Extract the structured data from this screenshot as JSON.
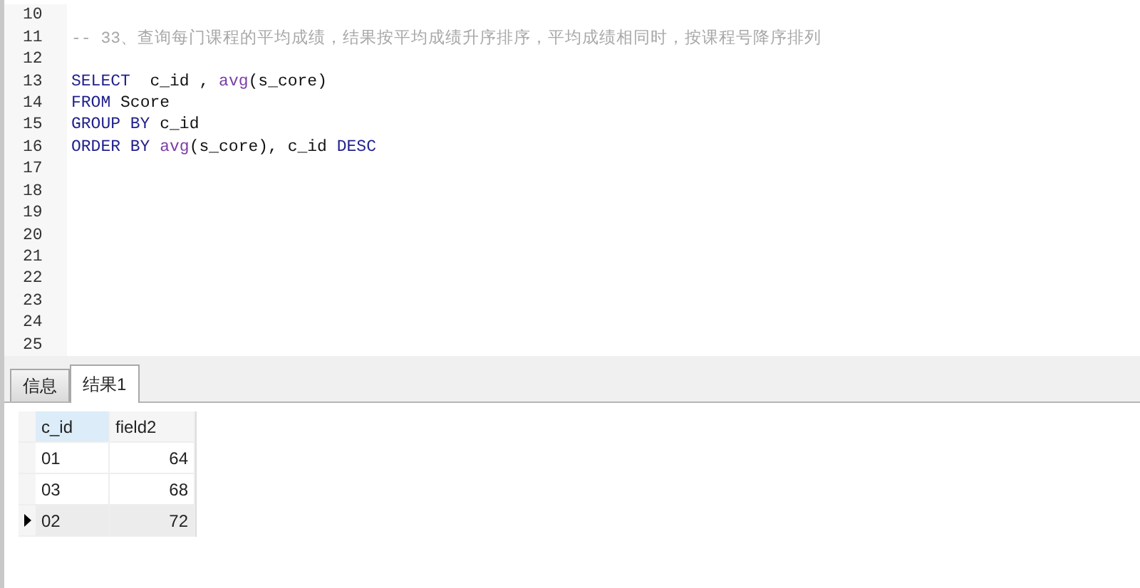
{
  "editor": {
    "lines": [
      {
        "number": "10"
      },
      {
        "number": "11",
        "tokens": [
          {
            "kind": "comment",
            "text": "-- 33、查询每门课程的平均成绩，结果按平均成绩升序排序，平均成绩相同时，按课程号降序排列"
          }
        ]
      },
      {
        "number": "12"
      },
      {
        "number": "13",
        "tokens": [
          {
            "kind": "keyword",
            "text": "SELECT"
          },
          {
            "kind": "plain",
            "text": "  c_id , "
          },
          {
            "kind": "function",
            "text": "avg"
          },
          {
            "kind": "plain",
            "text": "(s_core)"
          }
        ]
      },
      {
        "number": "14",
        "tokens": [
          {
            "kind": "keyword",
            "text": "FROM"
          },
          {
            "kind": "plain",
            "text": " Score"
          }
        ]
      },
      {
        "number": "15",
        "tokens": [
          {
            "kind": "keyword",
            "text": "GROUP BY"
          },
          {
            "kind": "plain",
            "text": " c_id"
          }
        ]
      },
      {
        "number": "16",
        "tokens": [
          {
            "kind": "keyword",
            "text": "ORDER BY"
          },
          {
            "kind": "function",
            "text": " avg"
          },
          {
            "kind": "plain",
            "text": "(s_core), c_id "
          },
          {
            "kind": "keyword",
            "text": "DESC"
          }
        ]
      },
      {
        "number": "17"
      },
      {
        "number": "18"
      },
      {
        "number": "19"
      },
      {
        "number": "20"
      },
      {
        "number": "21"
      },
      {
        "number": "22"
      },
      {
        "number": "23"
      },
      {
        "number": "24"
      },
      {
        "number": "25"
      }
    ]
  },
  "tabs": [
    {
      "label": "信息",
      "selected": false
    },
    {
      "label": "结果1",
      "selected": true
    }
  ],
  "grid": {
    "columns": [
      {
        "label": "c_id",
        "selected": true
      },
      {
        "label": "field2",
        "selected": false
      }
    ],
    "rows": [
      {
        "cells": [
          "01",
          "64"
        ],
        "selected": false
      },
      {
        "cells": [
          "03",
          "68"
        ],
        "selected": false
      },
      {
        "cells": [
          "02",
          "72"
        ],
        "selected": true
      }
    ]
  }
}
